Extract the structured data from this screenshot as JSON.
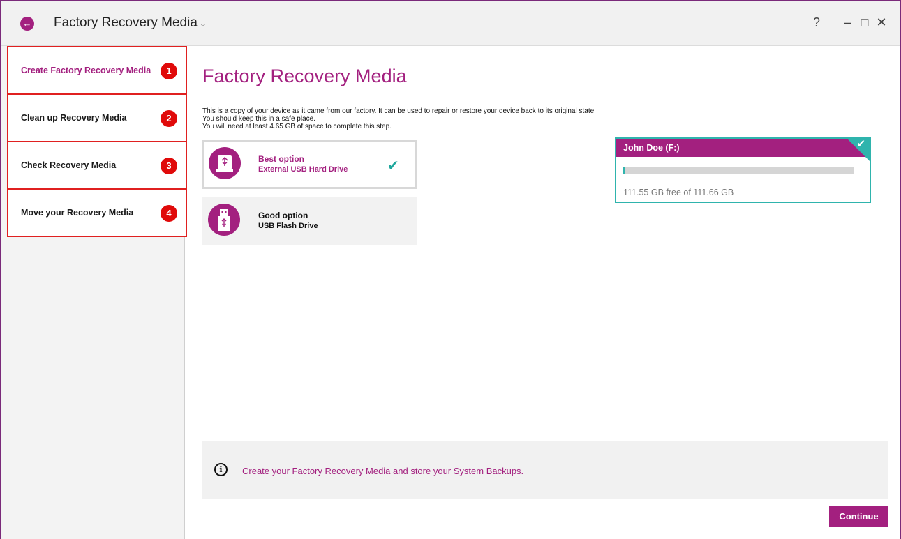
{
  "window": {
    "title": "Factory Recovery Media",
    "help": "?",
    "minimize": "–",
    "maximize": "□",
    "close": "✕"
  },
  "sidebar": {
    "items": [
      {
        "label": "Create Factory Recovery Media",
        "badge": "1",
        "active": true
      },
      {
        "label": "Clean up Recovery Media",
        "badge": "2",
        "active": false
      },
      {
        "label": "Check Recovery Media",
        "badge": "3",
        "active": false
      },
      {
        "label": "Move your Recovery Media",
        "badge": "4",
        "active": false
      }
    ]
  },
  "main": {
    "title": "Factory Recovery Media",
    "description": [
      "This is a copy of your device as it came from our factory. It can be used to repair or restore your device back to its original state.",
      "You should keep this in a safe place.",
      "You will need at least 4.65 GB of space to complete this step."
    ],
    "options": [
      {
        "title": "Best option",
        "subtitle": "External USB Hard Drive",
        "selected": true,
        "icon": "usb-hard-drive-icon"
      },
      {
        "title": "Good option",
        "subtitle": "USB Flash Drive",
        "selected": false,
        "icon": "usb-flash-drive-icon"
      }
    ],
    "drive": {
      "name": "John Doe (F:)",
      "free_text": "111.55 GB free of 111.66 GB",
      "used_fraction": 0.001,
      "selected": true
    },
    "info": {
      "icon": "info-icon",
      "text": "Create your Factory Recovery Media and store your System Backups."
    },
    "continue_label": "Continue"
  },
  "colors": {
    "accent": "#a3207f",
    "selection": "#2fb4ad",
    "badge": "#e00a0a"
  }
}
